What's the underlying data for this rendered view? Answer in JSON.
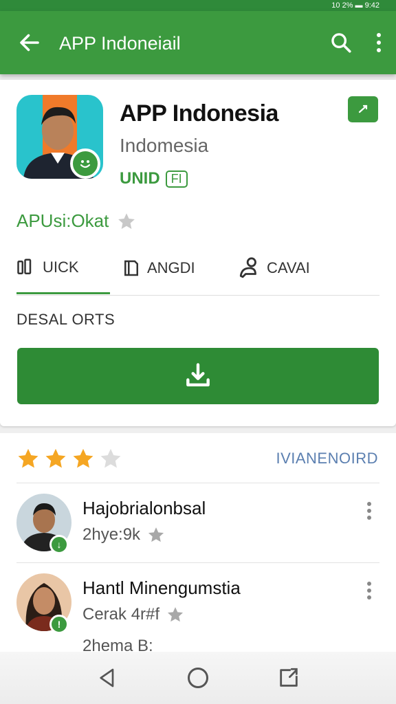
{
  "status_bar": {
    "text": "10 2% ▬ 9:42"
  },
  "app_bar": {
    "title": "APP Indoneiail"
  },
  "app": {
    "name": "APP Indonesia",
    "developer": "Indomesia",
    "tag": "UNID",
    "tag_box": "FI",
    "rating_text": "APUsi:Okat"
  },
  "tabs": [
    {
      "label": "UICK"
    },
    {
      "label": "ANGDI"
    },
    {
      "label": "CAVAI"
    }
  ],
  "section_label": "DESAL ORTS",
  "reviews_section": {
    "stars_filled": 3,
    "stars_total": 4,
    "see_more": "IVIANENOIRD"
  },
  "reviews": [
    {
      "name": "Hajobrialonbsal",
      "meta": "2hye:9k",
      "meta2": ""
    },
    {
      "name": "Hantl Minengumstia",
      "meta": "Cerak 4r#f",
      "meta2": "2hema B:"
    }
  ],
  "colors": {
    "primary": "#3c9a3f",
    "primary_dark": "#2e8b35",
    "star": "#f5a623",
    "link": "#5b7fb0"
  }
}
